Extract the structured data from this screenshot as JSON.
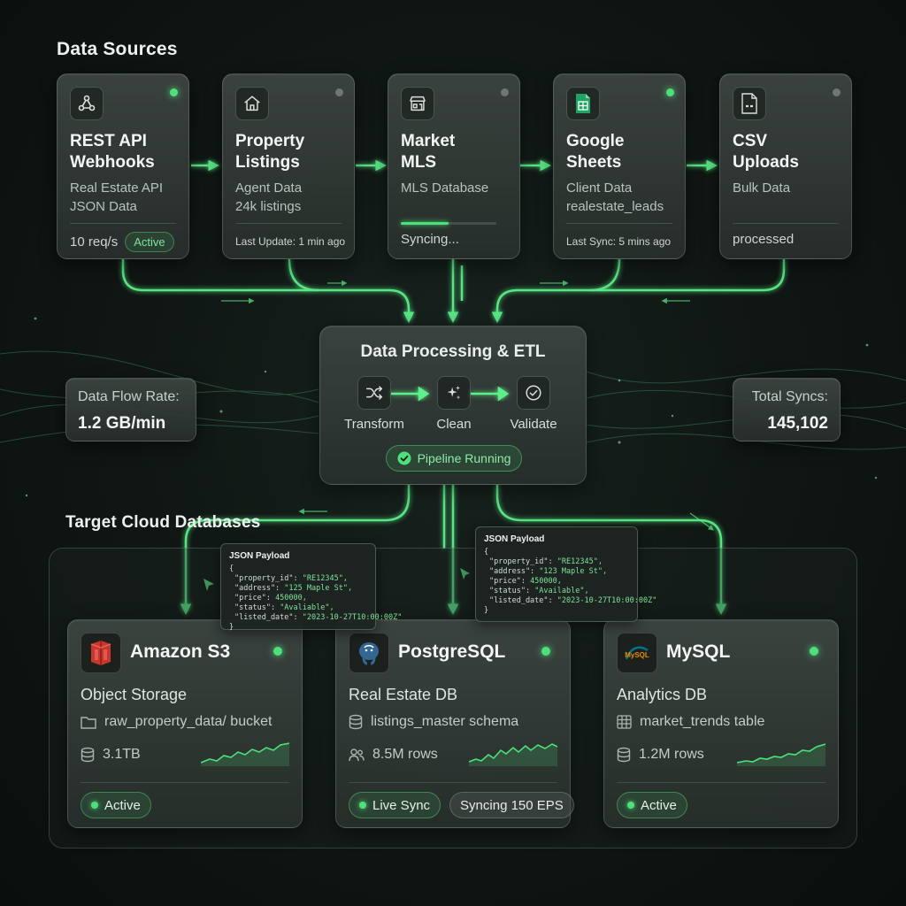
{
  "sections": {
    "sources_title": "Data Sources",
    "targets_title": "Target Cloud Databases"
  },
  "sources": [
    {
      "title_1": "REST API",
      "title_2": "Webhooks",
      "sub_1": "Real Estate API",
      "sub_2": "JSON Data",
      "footer": "10 req/s",
      "badge": "Active",
      "status": "online",
      "icon": "webhook-icon"
    },
    {
      "title_1": "Property",
      "title_2": "Listings",
      "sub_1": "Agent Data",
      "sub_2": "24k listings",
      "footer": "Last Update: 1 min ago",
      "status": "idle",
      "icon": "home-icon"
    },
    {
      "title_1": "Market",
      "title_2": "MLS",
      "sub_1": "MLS Database",
      "footer": "Syncing...",
      "progress": 0.5,
      "status": "idle",
      "icon": "storefront-icon"
    },
    {
      "title_1": "Google",
      "title_2": "Sheets",
      "sub_1": "Client Data",
      "sub_2": "realestate_leads",
      "footer": "Last Sync: 5 mins ago",
      "status": "online",
      "icon": "spreadsheet-icon"
    },
    {
      "title_1": "CSV",
      "title_2": "Uploads",
      "sub_1": "Bulk Data",
      "footer": "processed",
      "status": "idle",
      "icon": "csv-file-icon"
    }
  ],
  "etl": {
    "title": "Data Processing & ETL",
    "steps": [
      {
        "label": "Transform",
        "icon": "shuffle-icon"
      },
      {
        "label": "Clean",
        "icon": "sparkle-icon"
      },
      {
        "label": "Validate",
        "icon": "check-circle-icon"
      }
    ],
    "status": "Pipeline Running"
  },
  "stats": {
    "flow_label": "Data Flow Rate:",
    "flow_value": "1.2 GB/min",
    "syncs_label": "Total Syncs:",
    "syncs_value": "145,102"
  },
  "payload_left": {
    "title": "JSON Payload",
    "open": "{",
    "rows": [
      {
        "key": "\"property_id\": ",
        "value": "\"RE12345\","
      },
      {
        "key": "\"address\": ",
        "value": "\"125 Maple St\","
      },
      {
        "key": "\"price\": ",
        "value": "450000,"
      },
      {
        "key": "\"status\": ",
        "value": "\"Avaliable\","
      },
      {
        "key": "\"listed_date\": ",
        "value": "\"2023-10-27T10:00:00Z\""
      }
    ],
    "close": "}"
  },
  "payload_right": {
    "title": "JSON Payload",
    "open": "{",
    "rows": [
      {
        "key": "\"property_id\": ",
        "value": "\"RE12345\","
      },
      {
        "key": "\"address\": ",
        "value": "\"123 Maple St\","
      },
      {
        "key": "\"price\": ",
        "value": "450000,"
      },
      {
        "key": "\"status\": ",
        "value": "\"Available\","
      },
      {
        "key": "\"listed_date\": ",
        "value": "\"2023-10-27T10:00:00Z\""
      }
    ],
    "close": "}"
  },
  "targets": [
    {
      "name": "Amazon S3",
      "type": "Object Storage",
      "line1": "raw_property_data/ bucket",
      "line2": "3.1TB",
      "status": "Active",
      "logo": "aws-s3-logo",
      "line1_icon": "folder-icon",
      "line2_icon": "database-icon"
    },
    {
      "name": "PostgreSQL",
      "type": "Real Estate DB",
      "line1": "listings_master schema",
      "line2": "8.5M rows",
      "status": "Live Sync",
      "extra": "Syncing 150 EPS",
      "logo": "postgresql-logo",
      "line1_icon": "database-icon",
      "line2_icon": "users-icon"
    },
    {
      "name": "MySQL",
      "type": "Analytics DB",
      "line1": "market_trends table",
      "line2": "1.2M rows",
      "status": "Active",
      "logo": "mysql-logo",
      "logo_text": "MySQL",
      "line1_icon": "table-icon",
      "line2_icon": "database-icon"
    }
  ],
  "colors": {
    "accent": "#4ee07a",
    "flow_line": "#5cf08a",
    "background": "#101714",
    "s3": "#c8372d",
    "postgres": "#336791",
    "mysql": "#00758f"
  }
}
